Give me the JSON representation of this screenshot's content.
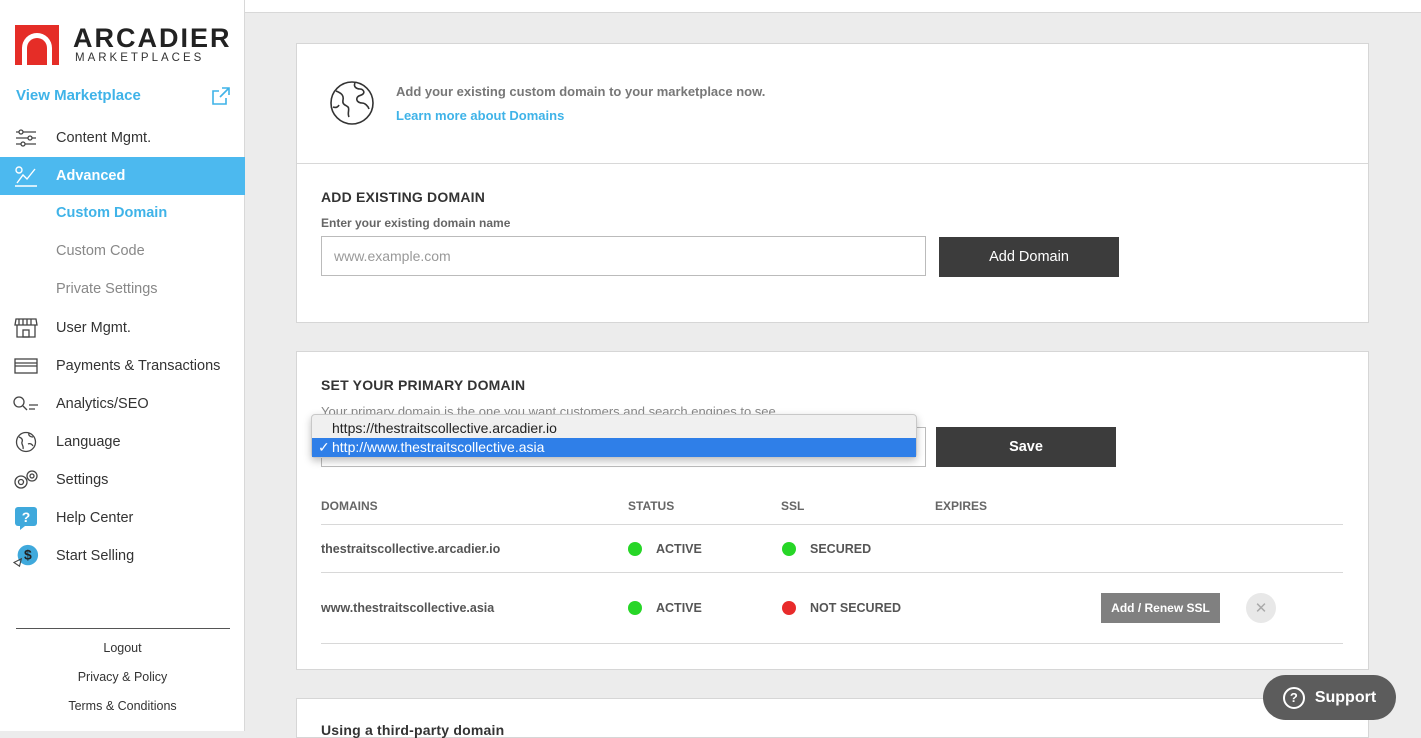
{
  "brand": {
    "name": "ARCADIER",
    "tagline": "MARKETPLACES",
    "accent": "#e52d27"
  },
  "sidebar": {
    "view_marketplace": "View Marketplace",
    "items": [
      {
        "label": "Content Mgmt.",
        "icon": "sliders-icon"
      },
      {
        "label": "Advanced",
        "icon": "advanced-icon",
        "active": true
      },
      {
        "label": "User Mgmt.",
        "icon": "storefront-icon"
      },
      {
        "label": "Payments & Transactions",
        "icon": "card-icon"
      },
      {
        "label": "Analytics/SEO",
        "icon": "search-chart-icon"
      },
      {
        "label": "Language",
        "icon": "globe-icon"
      },
      {
        "label": "Settings",
        "icon": "gears-icon"
      },
      {
        "label": "Help Center",
        "icon": "help-icon"
      },
      {
        "label": "Start Selling",
        "icon": "dollar-icon"
      }
    ],
    "sub_items": [
      {
        "label": "Custom Domain",
        "current": true
      },
      {
        "label": "Custom Code"
      },
      {
        "label": "Private Settings"
      }
    ],
    "footer": {
      "logout": "Logout",
      "privacy": "Privacy & Policy",
      "terms": "Terms & Conditions"
    },
    "active_color": "#4cb9ef"
  },
  "intro": {
    "text": "Add your existing custom domain to your marketplace now.",
    "link": "Learn more about Domains"
  },
  "add_domain": {
    "title": "ADD EXISTING DOMAIN",
    "label": "Enter your existing domain name",
    "placeholder": "www.example.com",
    "button": "Add Domain"
  },
  "primary": {
    "title": "SET YOUR PRIMARY DOMAIN",
    "description": "Your primary domain is the one you want customers and search engines to see.",
    "options": [
      "https://thestraitscollective.arcadier.io",
      "http://www.thestraitscollective.asia"
    ],
    "selected_check": "✓",
    "save": "Save"
  },
  "table": {
    "headers": [
      "DOMAINS",
      "STATUS",
      "SSL",
      "EXPIRES"
    ],
    "rows": [
      {
        "domain": "thestraitscollective.arcadier.io",
        "status": "ACTIVE",
        "status_color": "#27d627",
        "ssl": "SECURED",
        "ssl_color": "#27d627"
      },
      {
        "domain": "www.thestraitscollective.asia",
        "status": "ACTIVE",
        "status_color": "#27d627",
        "ssl": "NOT SECURED",
        "ssl_color": "#e82b2b",
        "action": "Add / Renew SSL",
        "remove": "✕"
      }
    ]
  },
  "third_party": {
    "title": "Using a third-party domain"
  },
  "support": {
    "label": "Support",
    "icon_glyph": "?"
  }
}
